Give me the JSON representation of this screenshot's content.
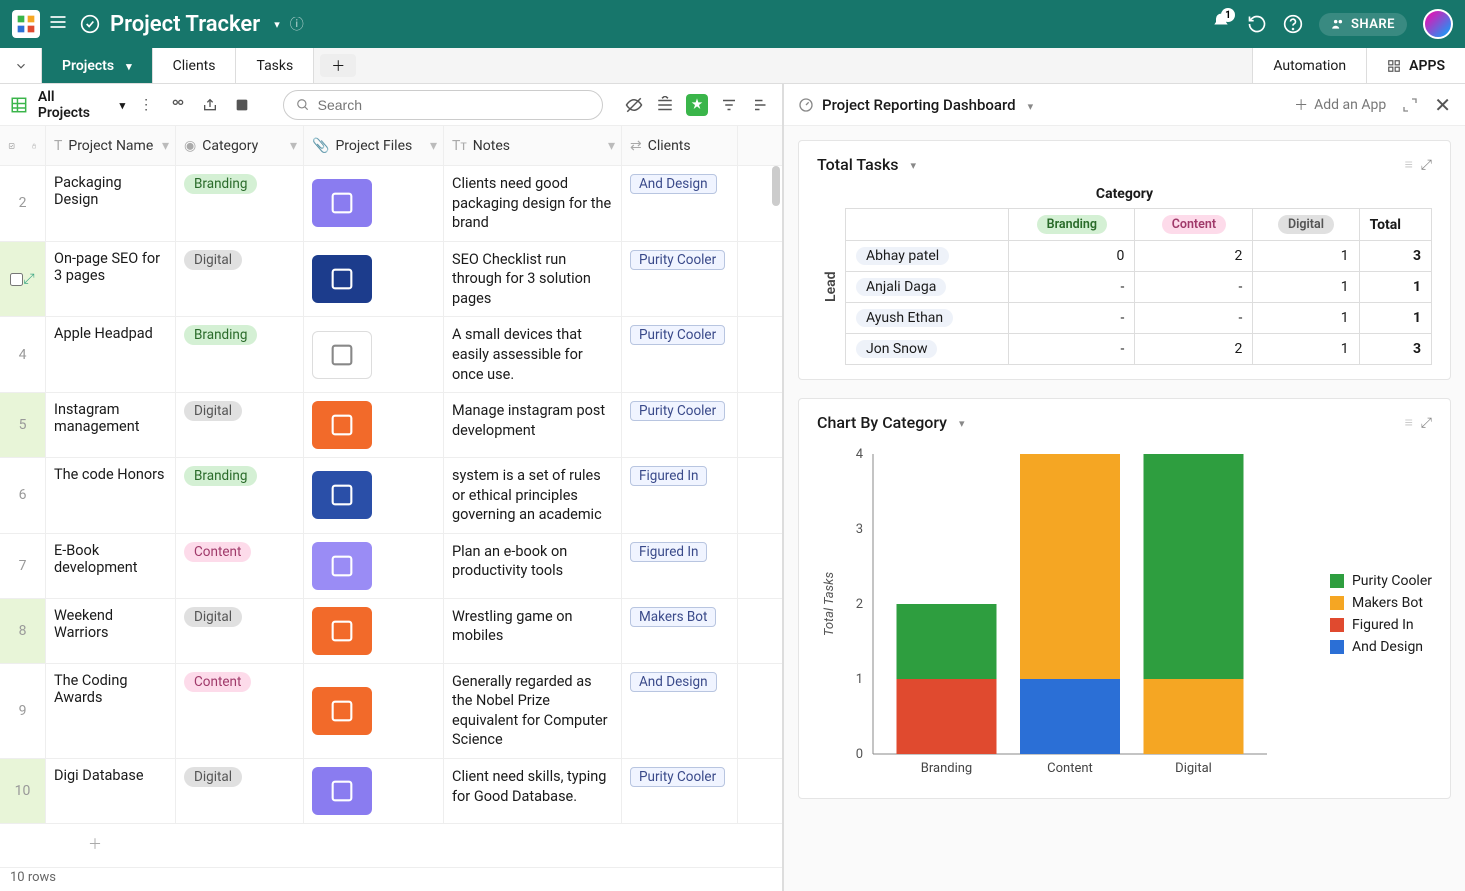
{
  "header": {
    "title": "Project Tracker",
    "share_label": "SHARE",
    "bell_badge": "1"
  },
  "tabs": {
    "items": [
      {
        "label": "Projects",
        "active": true
      },
      {
        "label": "Clients",
        "active": false
      },
      {
        "label": "Tasks",
        "active": false
      }
    ],
    "automation": "Automation",
    "apps": "APPS"
  },
  "view_toolbar": {
    "view_name": "All Projects",
    "search_placeholder": "Search"
  },
  "columns": {
    "name": "Project Name",
    "category": "Category",
    "files": "Project Files",
    "notes": "Notes",
    "clients": "Clients"
  },
  "rows": [
    {
      "n": "2",
      "hl": false,
      "name": "Packaging Design",
      "cat": "Branding",
      "cat_cls": "branding",
      "notes": "Clients need good packaging design for the brand",
      "client": "And Design",
      "thumb": "th-purple"
    },
    {
      "n": "",
      "hl": true,
      "name": "On-page SEO for 3 pages",
      "cat": "Digital",
      "cat_cls": "digital",
      "notes": "SEO Checklist run through for 3 solution pages",
      "client": "Purity Cooler",
      "thumb": "th-navy",
      "show_checkbox": true
    },
    {
      "n": "4",
      "hl": false,
      "name": "Apple Headpad",
      "cat": "Branding",
      "cat_cls": "branding",
      "notes": "A small devices that easily assessible for once use.",
      "client": "Purity Cooler",
      "thumb": "th-white"
    },
    {
      "n": "5",
      "hl": true,
      "name": "Instagram management",
      "cat": "Digital",
      "cat_cls": "digital",
      "notes": "Manage instagram post development",
      "client": "Purity Cooler",
      "thumb": "th-orange"
    },
    {
      "n": "6",
      "hl": false,
      "name": "The code Honors",
      "cat": "Branding",
      "cat_cls": "branding",
      "notes": "system is a set of rules or ethical principles governing an academic",
      "client": "Figured In",
      "thumb": "th-blue"
    },
    {
      "n": "7",
      "hl": false,
      "name": "E-Book development",
      "cat": "Content",
      "cat_cls": "content",
      "notes": "Plan an e-book on productivity tools",
      "client": "Figured In",
      "thumb": "th-lav"
    },
    {
      "n": "8",
      "hl": true,
      "name": "Weekend Warriors",
      "cat": "Digital",
      "cat_cls": "digital",
      "notes": "Wrestling game on mobiles",
      "client": "Makers Bot",
      "thumb": "th-orange"
    },
    {
      "n": "9",
      "hl": false,
      "name": "The Coding Awards",
      "cat": "Content",
      "cat_cls": "content",
      "notes": "Generally regarded as the Nobel Prize equivalent for Computer Science",
      "client": "And Design",
      "thumb": "th-orange"
    },
    {
      "n": "10",
      "hl": true,
      "name": "Digi Database",
      "cat": "Digital",
      "cat_cls": "digital",
      "notes": "Client need skills, typing for Good Database.",
      "client": "Purity Cooler",
      "thumb": "th-purple"
    }
  ],
  "footer": {
    "row_count": "10 rows"
  },
  "dashboard": {
    "title": "Project Reporting Dashboard",
    "add_app": "Add an App",
    "widget1": {
      "title": "Total Tasks",
      "axis_x": "Category",
      "axis_y": "Lead",
      "cols": [
        "Branding",
        "Content",
        "Digital",
        "Total"
      ],
      "rows": [
        {
          "lead": "Abhay patel",
          "v": [
            "0",
            "2",
            "1",
            "3"
          ]
        },
        {
          "lead": "Anjali Daga",
          "v": [
            "-",
            "-",
            "1",
            "1"
          ]
        },
        {
          "lead": "Ayush Ethan",
          "v": [
            "-",
            "-",
            "1",
            "1"
          ]
        },
        {
          "lead": "Jon Snow",
          "v": [
            "-",
            "2",
            "1",
            "3"
          ]
        }
      ]
    },
    "widget2": {
      "title": "Chart By Category"
    }
  },
  "chart_data": {
    "type": "bar",
    "stacked": true,
    "title": "Chart By Category",
    "xlabel": "",
    "ylabel": "Total Tasks",
    "ylim": [
      0,
      4
    ],
    "categories": [
      "Branding",
      "Content",
      "Digital"
    ],
    "series": [
      {
        "name": "Purity Cooler",
        "color": "#2e9e3f",
        "values": [
          1,
          0,
          3
        ]
      },
      {
        "name": "Makers Bot",
        "color": "#f5a623",
        "values": [
          0,
          3,
          1
        ]
      },
      {
        "name": "Figured In",
        "color": "#e04a2f",
        "values": [
          1,
          0,
          0
        ]
      },
      {
        "name": "And Design",
        "color": "#2b6fd6",
        "values": [
          0,
          1,
          0
        ]
      }
    ]
  }
}
